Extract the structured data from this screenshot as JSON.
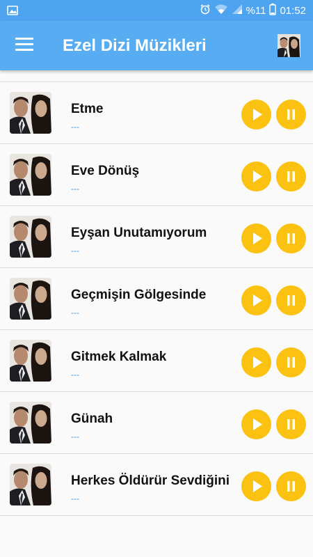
{
  "status_bar": {
    "battery_text": "%11",
    "time": "01:52"
  },
  "app_bar": {
    "title": "Ezel Dizi Müzikleri"
  },
  "songs": [
    {
      "title": "Etme",
      "subtitle": "---"
    },
    {
      "title": "Eve Dönüş",
      "subtitle": "---"
    },
    {
      "title": "Eyşan Unutamıyorum",
      "subtitle": "---"
    },
    {
      "title": "Geçmişin Gölgesinde",
      "subtitle": "---"
    },
    {
      "title": "Gitmek Kalmak",
      "subtitle": "---"
    },
    {
      "title": "Günah",
      "subtitle": "---"
    },
    {
      "title": "Herkes Öldürür Sevdiğini",
      "subtitle": "---"
    }
  ],
  "colors": {
    "status_bar": "#4fa4ef",
    "app_bar": "#57acf2",
    "button": "#fbc211",
    "subtitle": "#3a95e8"
  },
  "icons": {
    "menu": "hamburger-menu-icon",
    "play": "play-icon",
    "pause": "pause-icon"
  }
}
